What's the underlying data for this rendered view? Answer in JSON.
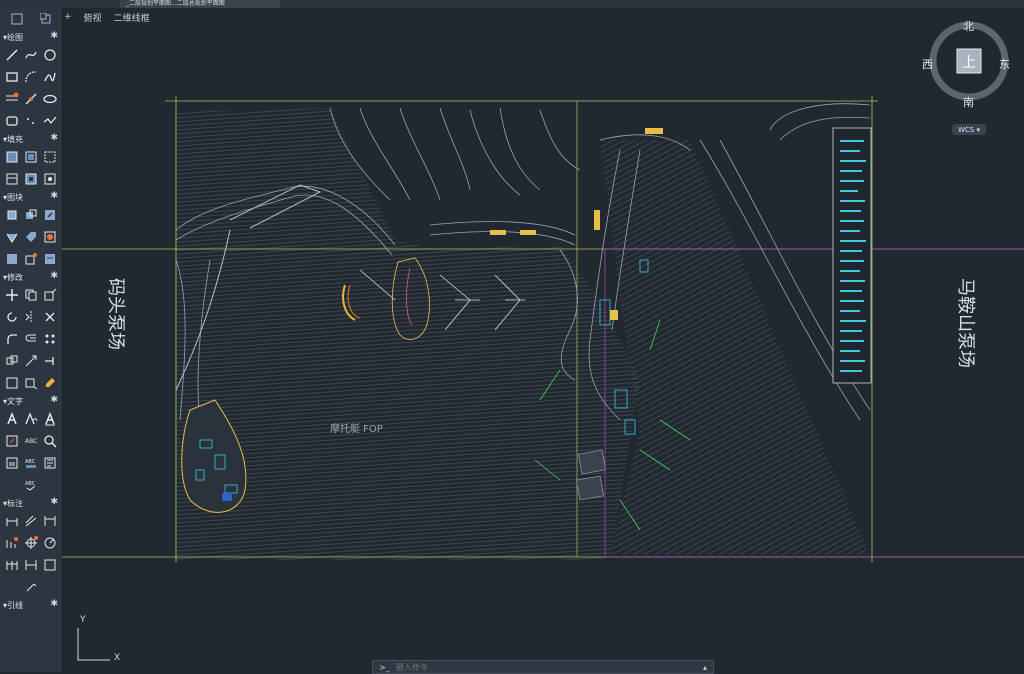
{
  "tabs": {
    "active": "_二层规划平面图...二层总规划平面图"
  },
  "viewbar": {
    "plus": "+",
    "view": "俯视",
    "style": "二维线框"
  },
  "palette": {
    "sections": [
      {
        "label": "绘图"
      },
      {
        "label": "填充"
      },
      {
        "label": "图块"
      },
      {
        "label": "修改"
      },
      {
        "label": "文字"
      },
      {
        "label": "标注"
      },
      {
        "label": "引线"
      }
    ]
  },
  "drawing": {
    "label_left": "码头泵场",
    "label_right": "马鞍山泵场",
    "label_center": "摩托艇 FOP"
  },
  "viewcube": {
    "north": "北",
    "south": "南",
    "east": "东",
    "west": "西",
    "top": "上",
    "wcs": "WCS"
  },
  "ucs": {
    "x": "X",
    "y": "Y"
  },
  "command": {
    "placeholder": "键入命令",
    "prompt": ">_"
  }
}
